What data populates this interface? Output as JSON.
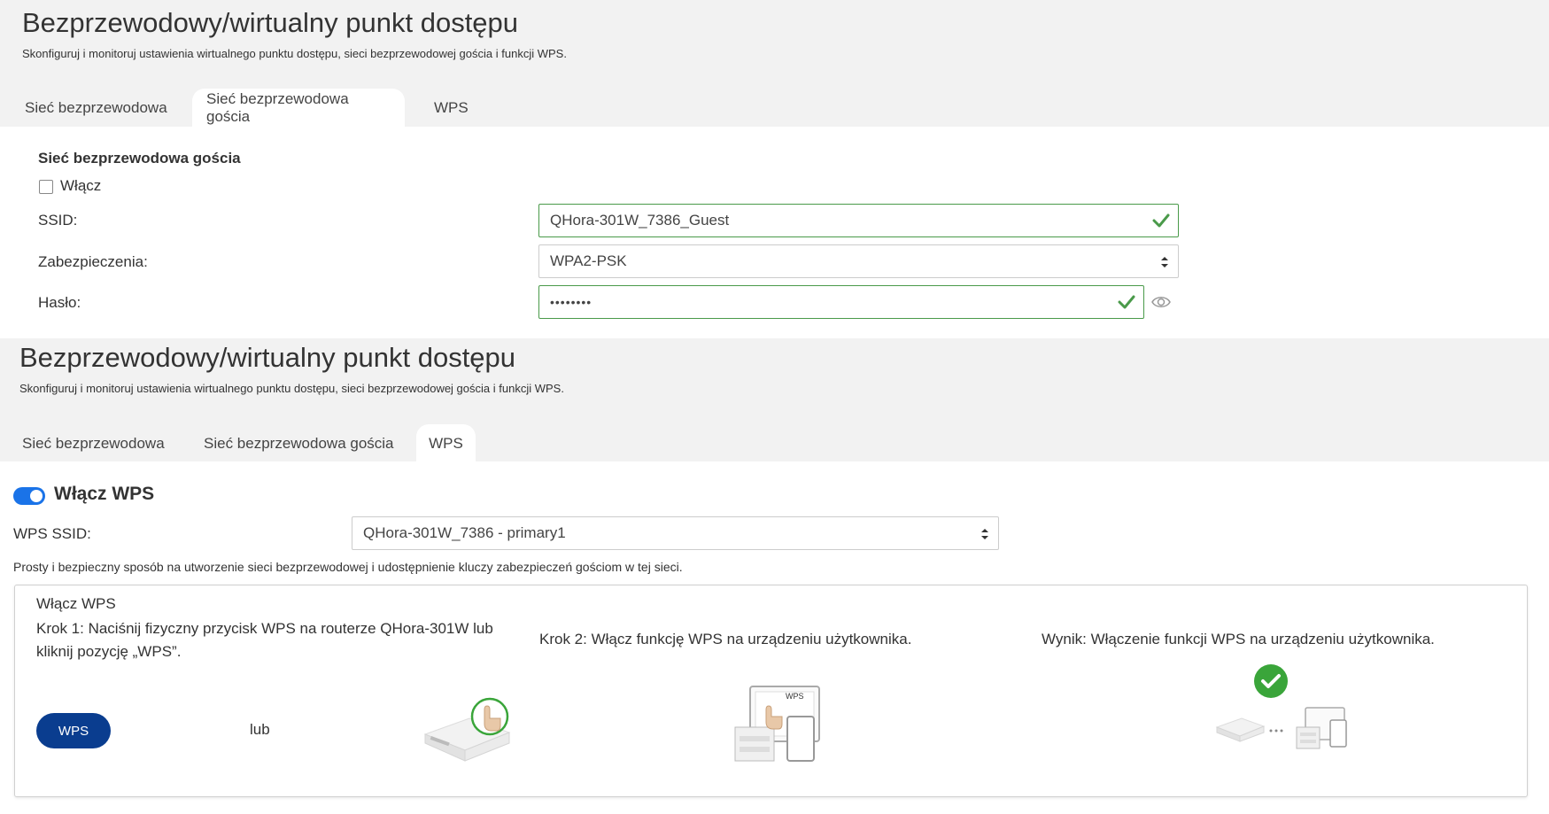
{
  "header": {
    "title": "Bezprzewodowy/wirtualny punkt dostępu",
    "subtitle": "Skonfiguruj i monitoruj ustawienia wirtualnego punktu dostępu, sieci bezprzewodowej gościa i funkcji WPS."
  },
  "tabs": [
    {
      "label": "Sieć bezprzewodowa"
    },
    {
      "label": "Sieć bezprzewodowa gościa"
    },
    {
      "label": "WPS"
    }
  ],
  "guest": {
    "section_title": "Sieć bezprzewodowa gościa",
    "enable_label": "Włącz",
    "enabled": false,
    "ssid_label": "SSID:",
    "ssid_value": "QHora-301W_7386_Guest",
    "security_label": "Zabezpieczenia:",
    "security_value": "WPA2-PSK",
    "password_label": "Hasło:",
    "password_value": "••••••••"
  },
  "wps": {
    "toggle_label": "Włącz WPS",
    "enabled": true,
    "ssid_label": "WPS SSID:",
    "ssid_value": "QHora-301W_7386 - primary1",
    "description": "Prosty i bezpieczny sposób na utworzenie sieci bezprzewodowej i udostępnienie kluczy zabezpieczeń gościom w tej sieci.",
    "card_title": "Włącz WPS",
    "step1": "Krok 1: Naciśnij fizyczny przycisk WPS na routerze QHora-301W lub kliknij pozycję „WPS”.",
    "step2": "Krok 2: Włącz funkcję WPS na urządzeniu użytkownika.",
    "result": "Wynik: Włączenie funkcji WPS na urządzeniu użytkownika.",
    "button_label": "WPS",
    "or_label": "lub",
    "screen_label": "WPS"
  },
  "colors": {
    "valid_green": "#4a9a4a",
    "toggle_blue": "#1a73e8",
    "wps_button": "#0a3d8f"
  }
}
